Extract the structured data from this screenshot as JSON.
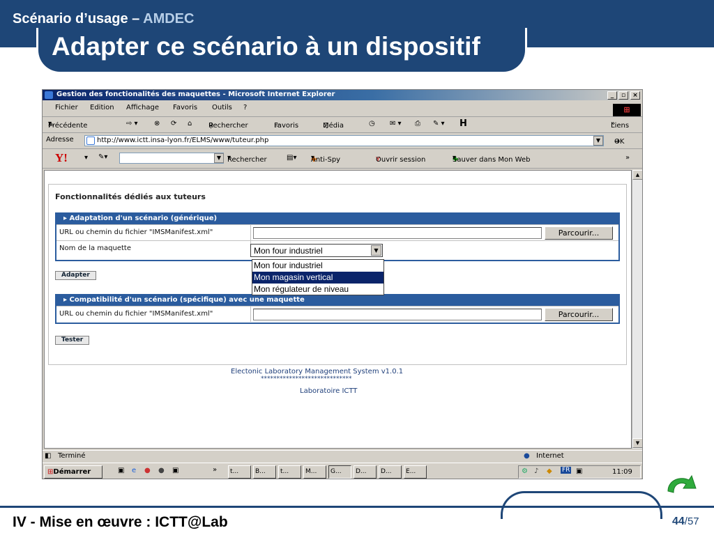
{
  "slide": {
    "section": "Scénario d’usage",
    "section_sep": " – ",
    "section_accent": "AMDEC",
    "title": "Adapter ce scénario à un dispositif",
    "footer_text": "IV - Mise en œuvre : ICTT@Lab",
    "page_current": "44",
    "page_total": "/57",
    "accent_color": "#1e4677"
  },
  "browser": {
    "title": "Gestion des fonctionalités des maquettes - Microsoft Internet Explorer",
    "menu": [
      "Fichier",
      "Edition",
      "Affichage",
      "Favoris",
      "Outils",
      "?"
    ],
    "toolbar": {
      "back": "Précédente",
      "search": "Rechercher",
      "favorites": "Favoris",
      "media": "Média",
      "links": "Liens"
    },
    "address_label": "Adresse",
    "address": "http://www.ictt.insa-lyon.fr/ELMS/www/tuteur.php",
    "go": "OK",
    "ybar": {
      "logo": "Y!",
      "search": "Rechercher",
      "antispy": "Anti-Spy",
      "session": "Ouvrir session",
      "save": "Sauver dans Mon Web"
    }
  },
  "page": {
    "heading": "Fonctionnalités dédiés aux tuteurs",
    "section1": {
      "header": "Adaptation d'un scénario (générique)",
      "url_label": "URL ou chemin du fichier \"IMSManifest.xml\"",
      "browse": "Parcourir...",
      "model_label": "Nom de la maquette",
      "selected": "Mon four industriel",
      "options": [
        "Mon four industriel",
        "Mon magasin vertical",
        "Mon régulateur de niveau"
      ],
      "highlighted": "Mon magasin vertical",
      "submit": "Adapter"
    },
    "section2": {
      "header": "Compatibilité d'un scénario (spécifique) avec une maquette",
      "url_label": "URL ou chemin du fichier \"IMSManifest.xml\"",
      "browse": "Parcourir...",
      "submit": "Tester"
    },
    "footer_title": "Electonic Laboratory Management System v1.0.1",
    "footer_stars": "*****************************",
    "footer_lab": "Laboratoire ICTT"
  },
  "status": {
    "text": "Terminé",
    "zone": "Internet"
  },
  "taskbar": {
    "start": "Démarrer",
    "chevron": "»",
    "buttons": [
      "t...",
      "B...",
      "t...",
      "M...",
      "G...",
      "D...",
      "D...",
      "E..."
    ],
    "clock": "11:09",
    "lang": "FR"
  }
}
